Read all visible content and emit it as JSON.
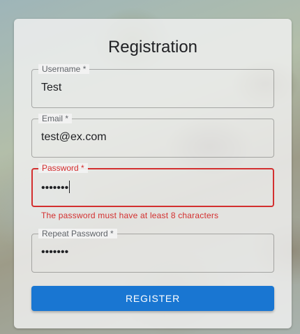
{
  "form": {
    "title": "Registration",
    "fields": [
      {
        "label": "Username *",
        "value": "Test",
        "type": "text"
      },
      {
        "label": "Email *",
        "value": "test@ex.com",
        "type": "email"
      },
      {
        "label": "Password *",
        "value": "•••••••",
        "type": "password",
        "error": "The password must have at least 8 characters"
      },
      {
        "label": "Repeat Password *",
        "value": "•••••••",
        "type": "password"
      }
    ],
    "submit_label": "REGISTER"
  },
  "colors": {
    "primary": "#1976d2",
    "error": "#d32f2f"
  }
}
